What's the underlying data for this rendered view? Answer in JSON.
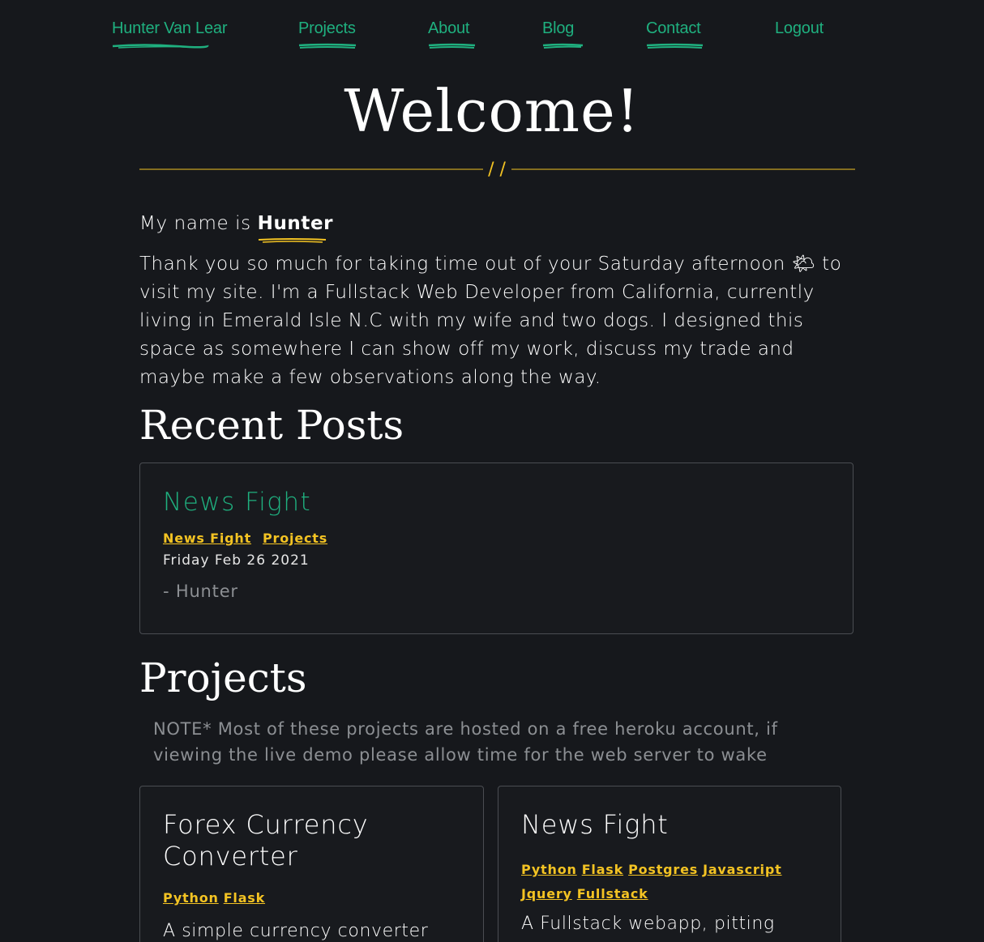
{
  "nav": {
    "brand": "Hunter Van Lear",
    "projects": "Projects",
    "about": "About",
    "blog": "Blog",
    "contact": "Contact",
    "logout": "Logout"
  },
  "hero": {
    "title": "Welcome!",
    "divider_glyphs": "/ /"
  },
  "intro": {
    "name_prefix": "My name is ",
    "name": "Hunter",
    "bio": "Thank you so much for taking time out of your Saturday afternoon 🌤 to visit my site. I'm a Fullstack Web Developer from California, currently living in Emerald Isle N.C with my wife and two dogs. I designed this space as somewhere I can show off my work, discuss my trade and maybe make a few observations along the way."
  },
  "recent_posts": {
    "heading": "Recent Posts",
    "posts": [
      {
        "title": "News Fight",
        "tags": [
          "News Fight",
          "Projects"
        ],
        "date": "Friday Feb 26 2021",
        "author": "- Hunter"
      }
    ]
  },
  "projects": {
    "heading": "Projects",
    "note": "NOTE* Most of these projects are hosted on a free heroku account, if viewing the live demo please allow time for the web server to wake",
    "items": [
      {
        "title": "Forex Currency Converter",
        "tags": [
          "Python",
          "Flask"
        ],
        "description": "A simple currency converter"
      },
      {
        "title": "News Fight",
        "tags": [
          "Python",
          "Flask",
          "Postgres",
          "Javascript",
          "Jquery",
          "Fullstack"
        ],
        "description": "A Fullstack webapp, pitting"
      }
    ]
  },
  "colors": {
    "background": "#16181c",
    "accent_green": "#1fb07f",
    "accent_yellow": "#f3c323",
    "muted_text": "#8c8f93",
    "card_border": "#4a4d52"
  }
}
